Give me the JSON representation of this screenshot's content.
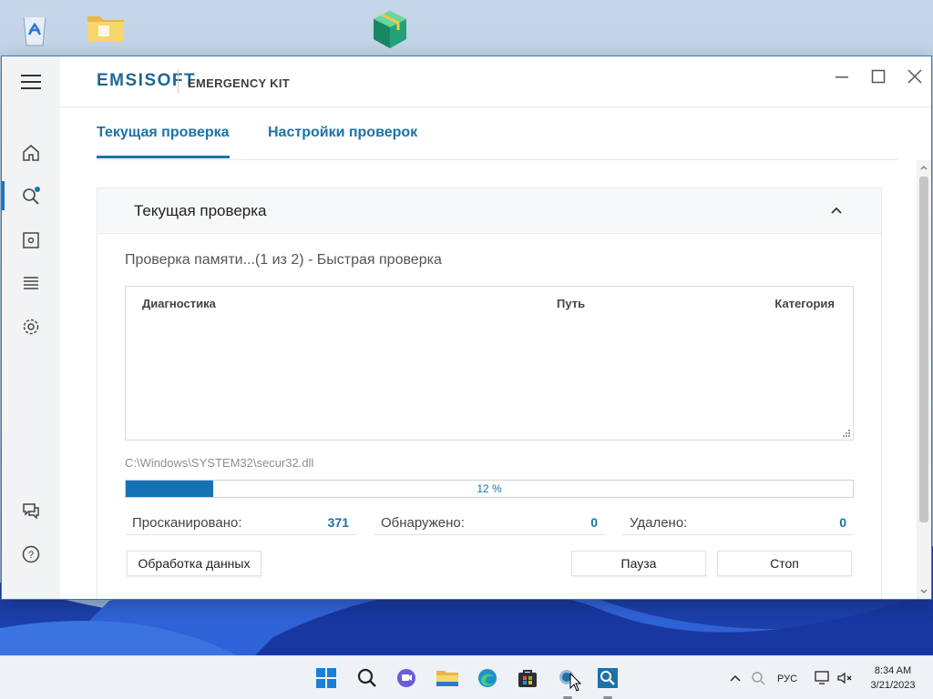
{
  "desktop": {
    "icons": [
      "recycle-bin-icon",
      "folder-icon",
      "package-icon"
    ]
  },
  "app": {
    "brand": "EMSISOFT",
    "product": "EMERGENCY KIT",
    "accent_color": "#1a73a8"
  },
  "sidebar": {
    "items": [
      {
        "name": "home-icon"
      },
      {
        "name": "scan-icon",
        "active": true
      },
      {
        "name": "quarantine-icon"
      },
      {
        "name": "logs-icon"
      },
      {
        "name": "settings-icon"
      },
      {
        "name": "feedback-icon"
      },
      {
        "name": "help-icon"
      }
    ]
  },
  "tabs": [
    {
      "label": "Текущая проверка",
      "active": true
    },
    {
      "label": "Настройки проверок",
      "active": false
    }
  ],
  "panel": {
    "title": "Текущая проверка",
    "status": "Проверка памяти...(1 из 2) - Быстрая проверка",
    "columns": [
      "Диагностика",
      "Путь",
      "Категория"
    ],
    "current_file": "C:\\Windows\\SYSTEM32\\secur32.dll",
    "progress_percent": 12,
    "progress_label": "12 %",
    "stats": [
      {
        "label": "Просканировано:",
        "value": "371"
      },
      {
        "label": "Обнаружено:",
        "value": "0"
      },
      {
        "label": "Удалено:",
        "value": "0"
      }
    ],
    "buttons": {
      "process": "Обработка данных",
      "pause": "Пауза",
      "stop": "Стоп"
    }
  },
  "taskbar": {
    "language": "РУС",
    "time": "8:34 AM",
    "date": "3/21/2023"
  }
}
